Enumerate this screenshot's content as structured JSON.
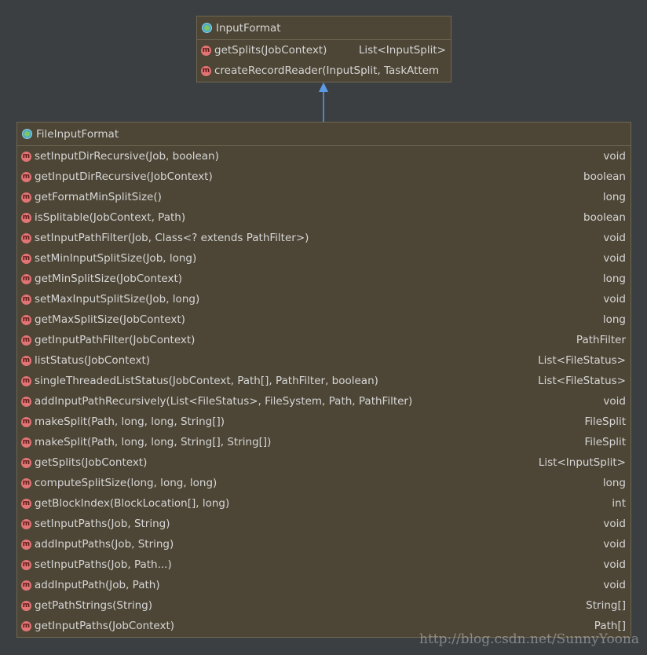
{
  "parent_class": {
    "name": "InputFormat",
    "icon": "class-icon",
    "methods": [
      {
        "signature": "getSplits(JobContext)",
        "returns": "List<InputSplit>"
      },
      {
        "signature": "createRecordReader(InputSplit, TaskAttempt",
        "returns": ""
      }
    ]
  },
  "child_class": {
    "name": "FileInputFormat",
    "icon": "class-icon",
    "methods": [
      {
        "signature": "setInputDirRecursive(Job, boolean)",
        "returns": "void"
      },
      {
        "signature": "getInputDirRecursive(JobContext)",
        "returns": "boolean"
      },
      {
        "signature": "getFormatMinSplitSize()",
        "returns": "long"
      },
      {
        "signature": "isSplitable(JobContext, Path)",
        "returns": "boolean"
      },
      {
        "signature": "setInputPathFilter(Job, Class<? extends PathFilter>)",
        "returns": "void"
      },
      {
        "signature": "setMinInputSplitSize(Job, long)",
        "returns": "void"
      },
      {
        "signature": "getMinSplitSize(JobContext)",
        "returns": "long"
      },
      {
        "signature": "setMaxInputSplitSize(Job, long)",
        "returns": "void"
      },
      {
        "signature": "getMaxSplitSize(JobContext)",
        "returns": "long"
      },
      {
        "signature": "getInputPathFilter(JobContext)",
        "returns": "PathFilter"
      },
      {
        "signature": "listStatus(JobContext)",
        "returns": "List<FileStatus>"
      },
      {
        "signature": "singleThreadedListStatus(JobContext, Path[], PathFilter, boolean)",
        "returns": "List<FileStatus>"
      },
      {
        "signature": "addInputPathRecursively(List<FileStatus>, FileSystem, Path, PathFilter)",
        "returns": "void"
      },
      {
        "signature": "makeSplit(Path, long, long, String[])",
        "returns": "FileSplit"
      },
      {
        "signature": "makeSplit(Path, long, long, String[], String[])",
        "returns": "FileSplit"
      },
      {
        "signature": "getSplits(JobContext)",
        "returns": "List<InputSplit>"
      },
      {
        "signature": "computeSplitSize(long, long, long)",
        "returns": "long"
      },
      {
        "signature": "getBlockIndex(BlockLocation[], long)",
        "returns": "int"
      },
      {
        "signature": "setInputPaths(Job, String)",
        "returns": "void"
      },
      {
        "signature": "addInputPaths(Job, String)",
        "returns": "void"
      },
      {
        "signature": "setInputPaths(Job, Path...)",
        "returns": "void"
      },
      {
        "signature": "addInputPath(Job, Path)",
        "returns": "void"
      },
      {
        "signature": "getPathStrings(String)",
        "returns": "String[]"
      },
      {
        "signature": "getInputPaths(JobContext)",
        "returns": "Path[]"
      }
    ]
  },
  "relationship": "inheritance",
  "watermark": "http://blog.csdn.net/SunnyYoona",
  "colors": {
    "background": "#3c3f41",
    "box_fill": "#4d4636",
    "box_border": "#6e6651",
    "arrow": "#5b9be6",
    "method_icon": "#e27474",
    "text": "#d6d6d6"
  }
}
